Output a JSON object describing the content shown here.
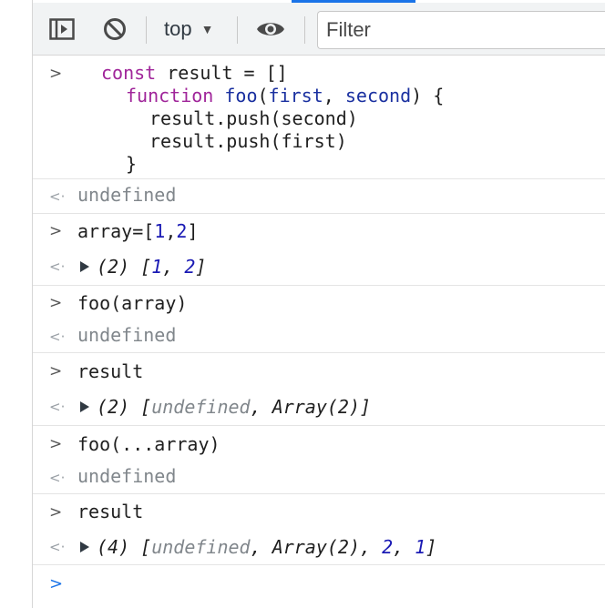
{
  "toolbar": {
    "sidebar_icon": "sidebar-toggle-icon",
    "clear_icon": "clear-console-icon",
    "context_label": "top",
    "context_caret": "▼",
    "eye_icon": "live-expression-eye-icon",
    "filter_placeholder": "Filter"
  },
  "prompts": {
    "input": ">",
    "output": "<·",
    "final": ">"
  },
  "console": {
    "entry1": {
      "line1_kw": "const",
      "line1_rest": " result = []",
      "line2_kw": "function",
      "line2_fn": "foo",
      "line2_p1": "(",
      "line2_arg1": "first",
      "line2_p2": ", ",
      "line2_arg2": "second",
      "line2_p3": ") {",
      "line3": "result.push(second)",
      "line4": "result.push(first)",
      "line5": "}",
      "result": "undefined"
    },
    "entry2": {
      "input_a": "array=[",
      "input_n1": "1",
      "input_comma": ",",
      "input_n2": "2",
      "input_b": "]",
      "result_count": "(2)",
      "result_open": "[",
      "result_n1": "1",
      "result_sep": ", ",
      "result_n2": "2",
      "result_close": "]"
    },
    "entry3": {
      "input": "foo(array)",
      "result": "undefined"
    },
    "entry4": {
      "input": "result",
      "result_count": "(2)",
      "result_open": "[",
      "result_undef": "undefined",
      "result_sep": ", ",
      "result_arr": "Array(2)",
      "result_close": "]"
    },
    "entry5": {
      "input": "foo(...array)",
      "result": "undefined"
    },
    "entry6": {
      "input": "result",
      "result_count": "(4)",
      "result_open": "[",
      "result_undef": "undefined",
      "result_sep": ", ",
      "result_arr": "Array(2)",
      "result_n1": "2",
      "result_n2": "1",
      "result_close": "]"
    }
  },
  "colors": {
    "keyword": "#a0259a",
    "function_name": "#1a30a0",
    "number": "#1a1ab4",
    "muted": "#80868b",
    "accent": "#1a73e8"
  }
}
